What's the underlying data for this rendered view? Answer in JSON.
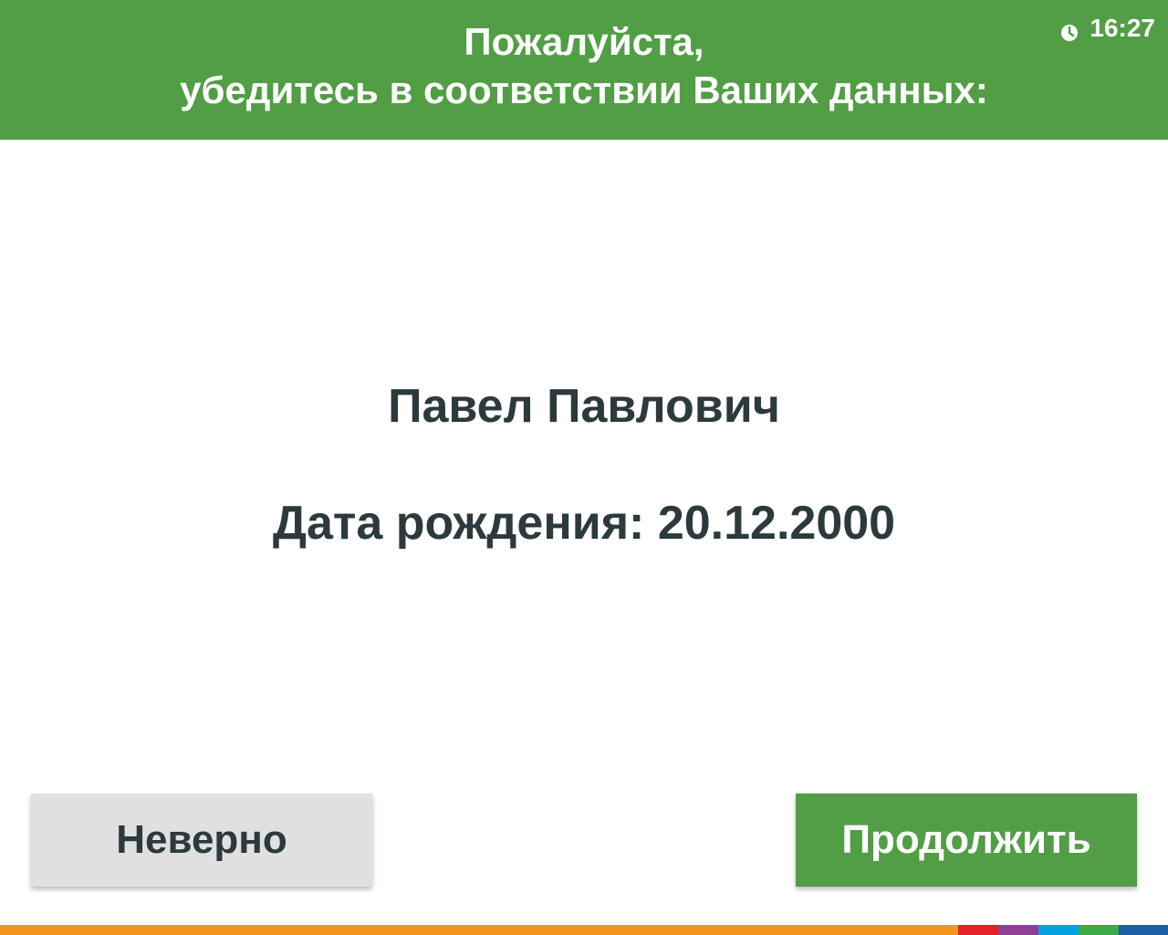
{
  "header": {
    "title_line1": "Пожалуйста,",
    "title_line2": "убедитесь в соответствии Ваших данных:",
    "clock_icon": "clock-icon",
    "time": "16:27"
  },
  "main": {
    "full_name": "Павел Павлович",
    "birth_date": "Дата рождения: 20.12.2000"
  },
  "buttons": {
    "wrong_label": "Неверно",
    "continue_label": "Продолжить"
  },
  "colors": {
    "header_bg": "#519e45",
    "text_dark": "#2c393d",
    "button_secondary_bg": "#e0e0e0",
    "button_primary_bg": "#519e45",
    "bottom_stripe": [
      "#f7941d",
      "#e4212b",
      "#8e3f95",
      "#00a2e2",
      "#3aab47",
      "#1b5ea8"
    ]
  }
}
